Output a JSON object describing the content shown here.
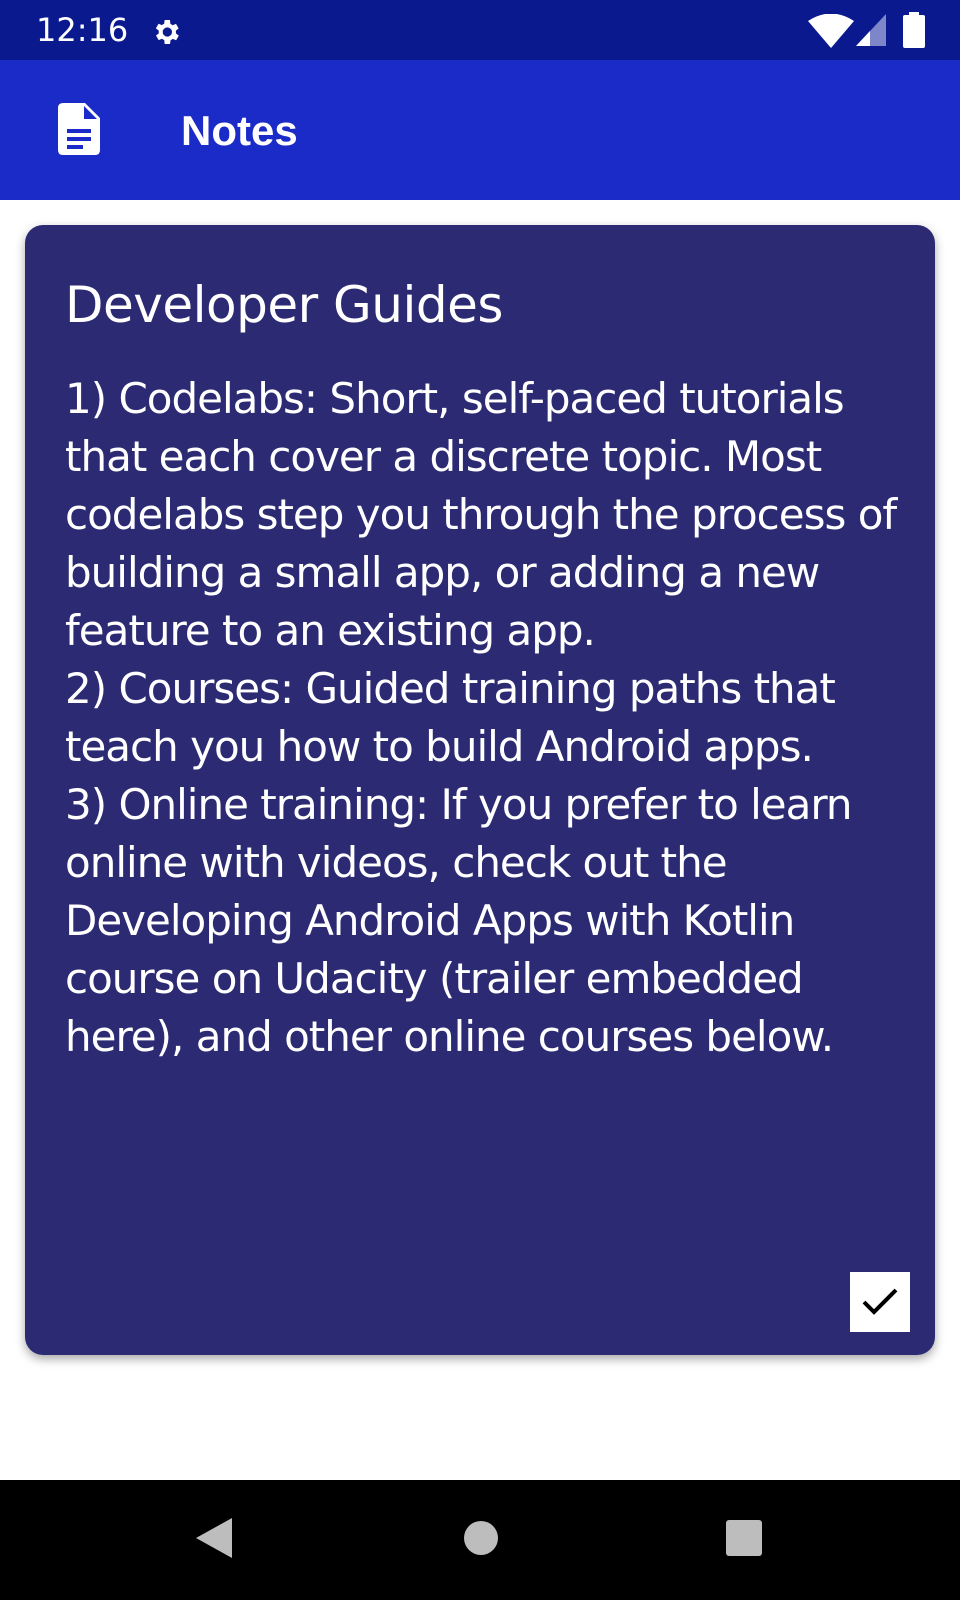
{
  "status_bar": {
    "time": "12:16",
    "icons": [
      "gear-icon",
      "wifi-icon",
      "cell-signal-icon",
      "battery-icon"
    ],
    "background": "#0a1a8e"
  },
  "app_bar": {
    "title": "Notes",
    "icon": "document-icon",
    "background": "#1a2bc7"
  },
  "note": {
    "title": "Developer Guides",
    "body": "1) Codelabs: Short, self-paced tutorials that each cover a discrete topic. Most codelabs step you through the process of building a small app, or adding a new feature to an existing app.\n2) Courses: Guided training paths that teach you how to build Android apps.\n3) Online training: If you prefer to learn online with videos, check out the Developing Android Apps with Kotlin course on Udacity (trailer embedded here), and other online courses below.",
    "checked": true,
    "card_color": "#2b2a72"
  },
  "nav_bar": {
    "buttons": [
      "back-icon",
      "home-icon",
      "recents-icon"
    ]
  }
}
